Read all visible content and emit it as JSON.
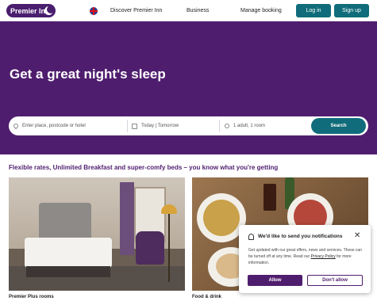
{
  "header": {
    "logo_text": "Premier Inn",
    "nav": [
      "Discover Premier Inn",
      "Business",
      "Manage booking"
    ],
    "login_label": "Log in",
    "signup_label": "Sign up"
  },
  "hero": {
    "title": "Get a great night's sleep"
  },
  "search": {
    "location_placeholder": "Enter place, postcode or hotel",
    "dates": "Today | Tomorrow",
    "guests": "1 adult, 1 room",
    "button_label": "Search"
  },
  "content": {
    "tagline": "Flexible rates, Unlimited Breakfast and super-comfy beds – you know what you're getting",
    "cards": [
      {
        "caption": "Premier Plus rooms"
      },
      {
        "caption": "Food & drink"
      }
    ]
  },
  "notification": {
    "title": "We'd like to send you notifications",
    "body_text": "Get updated with our great offers, news and services. These can be turned off at any time. Read our",
    "link_text": "Privacy Policy",
    "body_suffix": "for more information.",
    "allow_label": "Allow",
    "deny_label": "Don't allow"
  },
  "colors": {
    "brand_purple": "#4f1d6e",
    "accent_teal": "#106c7a"
  },
  "icons": [
    "moon-icon",
    "uk-flag-icon",
    "location-pin-icon",
    "calendar-icon",
    "person-icon",
    "bell-icon",
    "close-icon"
  ]
}
